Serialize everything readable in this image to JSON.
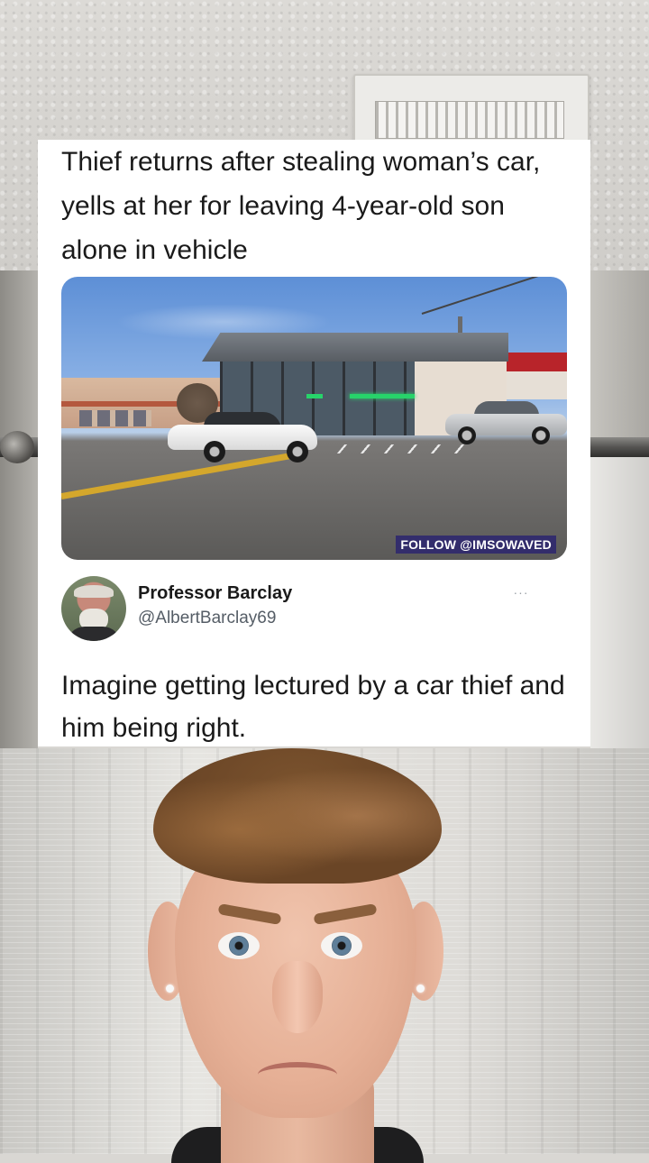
{
  "post": {
    "headline": "Thief returns after stealing woman’s car, yells at her for leaving 4-year-old son alone in vehicle",
    "photo_watermark": "FOLLOW @IMSOWAVED",
    "author": {
      "name": "Professor Barclay",
      "handle": "@AlbertBarclay69"
    },
    "more_icon": "···",
    "tweet_text": "Imagine getting lectured by a car thief and him being right."
  },
  "colors": {
    "card_background": "#ffffff",
    "watermark_background": "#2c246e",
    "handle_gray": "#555d66"
  }
}
